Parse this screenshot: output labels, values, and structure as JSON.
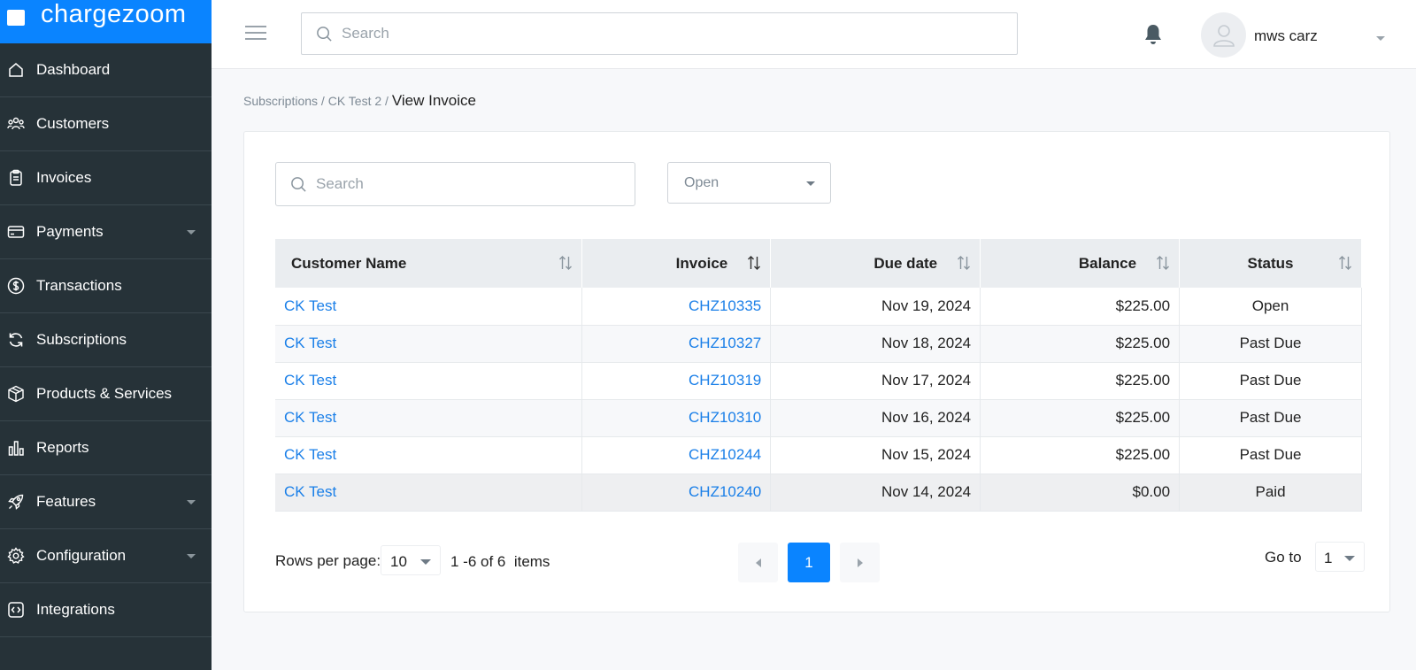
{
  "brand": {
    "name": "chargezoom",
    "color": "#0a84ff"
  },
  "sidebar": {
    "items": [
      {
        "label": "Dashboard",
        "icon": "home-icon",
        "has_caret": false
      },
      {
        "label": "Customers",
        "icon": "people-icon",
        "has_caret": false
      },
      {
        "label": "Invoices",
        "icon": "clipboard-icon",
        "has_caret": false
      },
      {
        "label": "Payments",
        "icon": "credit-card-icon",
        "has_caret": true
      },
      {
        "label": "Transactions",
        "icon": "dollar-circle-icon",
        "has_caret": false
      },
      {
        "label": "Subscriptions",
        "icon": "refresh-icon",
        "has_caret": false
      },
      {
        "label": "Products & Services",
        "icon": "box-icon",
        "has_caret": false
      },
      {
        "label": "Reports",
        "icon": "bar-chart-icon",
        "has_caret": false
      },
      {
        "label": "Features",
        "icon": "rocket-icon",
        "has_caret": true
      },
      {
        "label": "Configuration",
        "icon": "gear-icon",
        "has_caret": true
      },
      {
        "label": "Integrations",
        "icon": "code-icon",
        "has_caret": false
      }
    ]
  },
  "header": {
    "search_placeholder": "Search",
    "user_name": "mws carz"
  },
  "breadcrumb": {
    "items": [
      "Subscriptions",
      "CK Test 2"
    ],
    "separator": " / ",
    "current": "View Invoice"
  },
  "filters": {
    "search_placeholder": "Search",
    "status_value": "Open"
  },
  "table": {
    "columns": [
      "Customer Name",
      "Invoice",
      "Due date",
      "Balance",
      "Status"
    ],
    "rows": [
      {
        "customer": "CK Test",
        "invoice": "CHZ10335",
        "due": "Nov 19, 2024",
        "balance": "$225.00",
        "status": "Open"
      },
      {
        "customer": "CK Test",
        "invoice": "CHZ10327",
        "due": "Nov 18, 2024",
        "balance": "$225.00",
        "status": "Past Due"
      },
      {
        "customer": "CK Test",
        "invoice": "CHZ10319",
        "due": "Nov 17, 2024",
        "balance": "$225.00",
        "status": "Past Due"
      },
      {
        "customer": "CK Test",
        "invoice": "CHZ10310",
        "due": "Nov 16, 2024",
        "balance": "$225.00",
        "status": "Past Due"
      },
      {
        "customer": "CK Test",
        "invoice": "CHZ10244",
        "due": "Nov 15, 2024",
        "balance": "$225.00",
        "status": "Past Due"
      },
      {
        "customer": "CK Test",
        "invoice": "CHZ10240",
        "due": "Nov 14, 2024",
        "balance": "$0.00",
        "status": "Paid"
      }
    ]
  },
  "pagination": {
    "rows_label": "Rows per page:",
    "rows_per_page": "10",
    "range_text": "1 -6 of 6  items",
    "current_page": "1",
    "goto_label": "Go to",
    "goto_value": "1"
  }
}
